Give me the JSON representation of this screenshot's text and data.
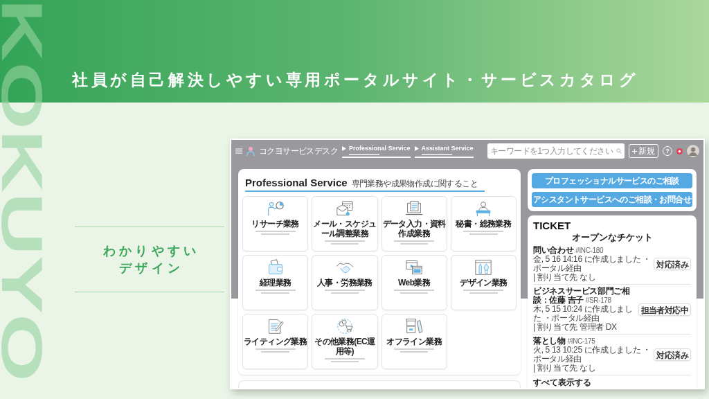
{
  "slide": {
    "brand_wordmark": "KOKUYO",
    "title": "社員が自己解決しやすい専用ポータルサイト・サービスカタログ",
    "feature_heading": "わかりやすいデザイン"
  },
  "portal": {
    "app_name": "コクヨサービスデスク",
    "nav_tabs": [
      "Professional Service",
      "Assistant Service"
    ],
    "search": {
      "placeholder": "キーワードを1つ入力してください"
    },
    "new_button": "新規",
    "help_button": "?",
    "service_panel": {
      "title": "Professional Service",
      "subtitle": "専門業務や成果物作成に関すること",
      "services": [
        "リサーチ業務",
        "メール・スケジュール調整業務",
        "データ入力・資料作成業務",
        "秘書・総務業務",
        "経理業務",
        "人事・労務業務",
        "Web業務",
        "デザイン業務",
        "ライティング業務",
        "その他業務(EC運用等)",
        "オフライン業務"
      ]
    },
    "consult_buttons": [
      "プロフェッショナルサービスのご相談",
      "アシスタントサービスへのご相談・お問合せ"
    ],
    "tickets": {
      "title": "TICKET",
      "heading": "オープンなチケット",
      "items": [
        {
          "title": "問い合わせ",
          "number": "#INC-180",
          "meta": "金, 5 16 14:16 に作成しました ・ポータル経由",
          "assignee": "| 割り当て先 なし",
          "status": "対応済み"
        },
        {
          "title": "ビジネスサービス部門ご相談：佐藤 吉子",
          "number": "#SR-178",
          "meta": "木, 5 15 10:24 に作成しました ・ポータル経由",
          "assignee": "| 割り当て先 管理者 DX",
          "status": "担当者対応中"
        },
        {
          "title": "落とし物",
          "number": "#INC-175",
          "meta": "火, 5 13 10:25 に作成しました ・ポータル経由",
          "assignee": "| 割り当て先 なし",
          "status": "対応済み"
        }
      ],
      "show_all": "すべて表示する"
    }
  }
}
